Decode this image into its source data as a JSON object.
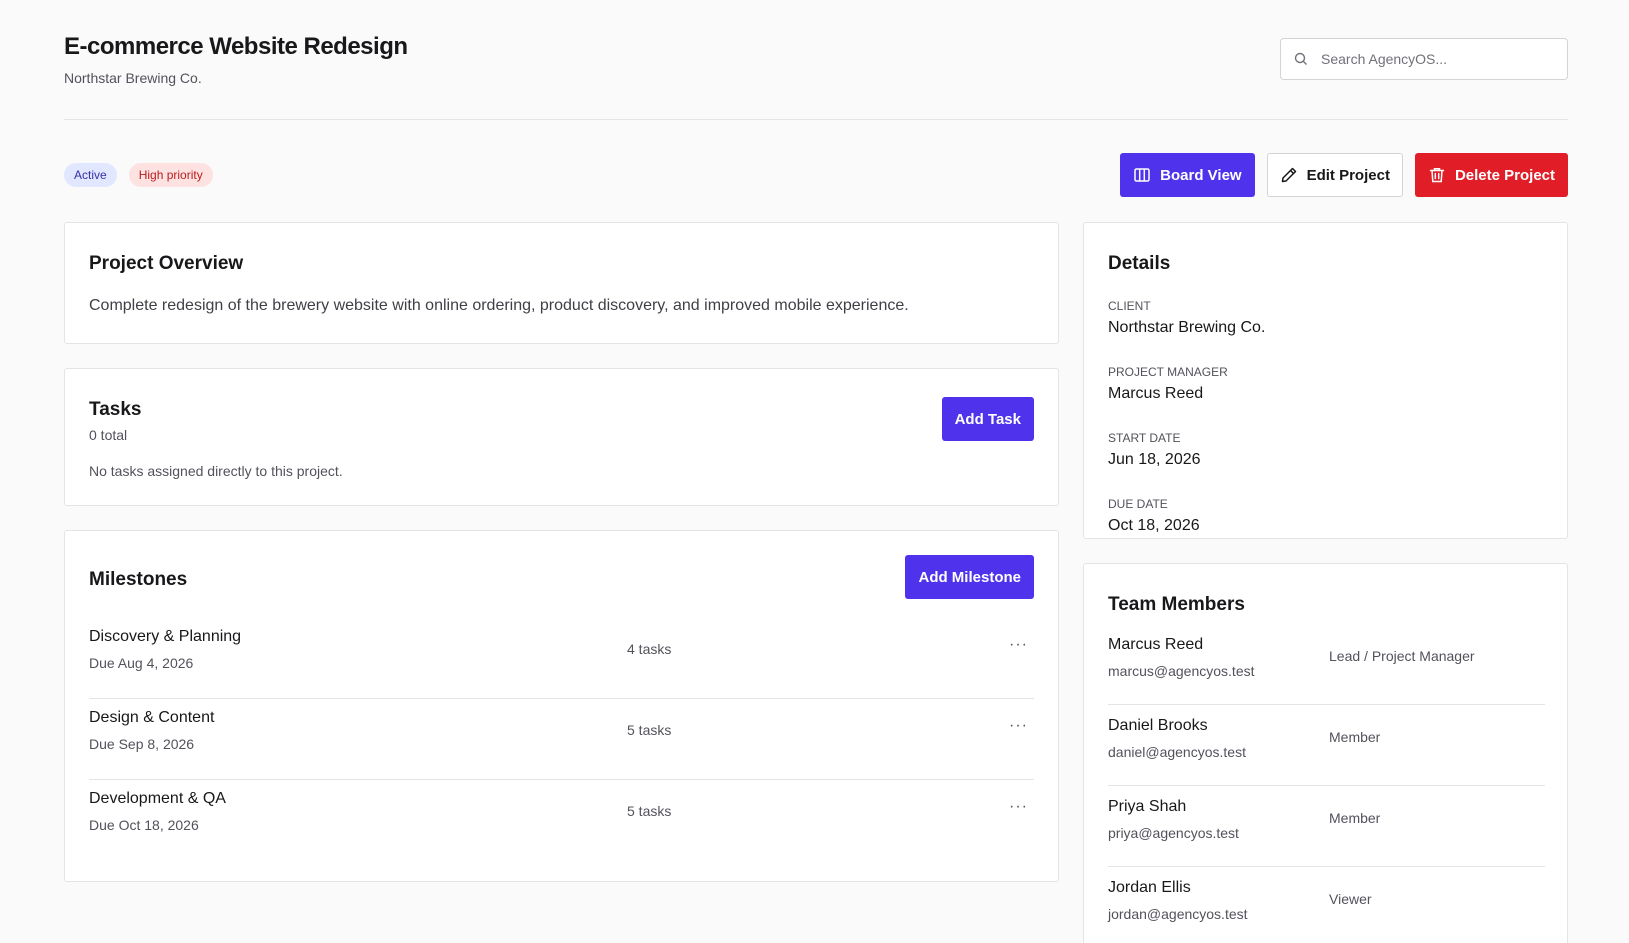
{
  "header": {
    "title": "E-commerce Website Redesign",
    "subtitle": "Northstar Brewing Co.",
    "search_placeholder": "Search AgencyOS..."
  },
  "badges": {
    "status": "Active",
    "priority": "High priority"
  },
  "actions": {
    "board_view": "Board View",
    "edit_project": "Edit Project",
    "delete_project": "Delete Project"
  },
  "overview": {
    "title": "Project Overview",
    "description": "Complete redesign of the brewery website with online ordering, product discovery, and improved mobile experience."
  },
  "tasks": {
    "title": "Tasks",
    "count": "0 total",
    "empty_message": "No tasks assigned directly to this project.",
    "add_label": "Add Task"
  },
  "milestones": {
    "title": "Milestones",
    "add_label": "Add Milestone",
    "items": [
      {
        "name": "Discovery & Planning",
        "due": "Due Aug 4, 2026",
        "tasks": "4 tasks"
      },
      {
        "name": "Design & Content",
        "due": "Due Sep 8, 2026",
        "tasks": "5 tasks"
      },
      {
        "name": "Development & QA",
        "due": "Due Oct 18, 2026",
        "tasks": "5 tasks"
      }
    ],
    "more_label": "···"
  },
  "details": {
    "title": "Details",
    "client_label": "Client",
    "client": "Northstar Brewing Co.",
    "manager_label": "Project Manager",
    "manager": "Marcus Reed",
    "start_label": "Start Date",
    "start": "Jun 18, 2026",
    "due_label": "Due Date",
    "due": "Oct 18, 2026"
  },
  "team": {
    "title": "Team Members",
    "members": [
      {
        "name": "Marcus Reed",
        "email": "marcus@agencyos.test",
        "role": "Lead / Project Manager"
      },
      {
        "name": "Daniel Brooks",
        "email": "daniel@agencyos.test",
        "role": "Member"
      },
      {
        "name": "Priya Shah",
        "email": "priya@agencyos.test",
        "role": "Member"
      },
      {
        "name": "Jordan Ellis",
        "email": "jordan@agencyos.test",
        "role": "Viewer"
      }
    ]
  },
  "colors": {
    "primary": "#4f33ec",
    "danger": "#e11d27",
    "badge_active_bg": "#e0e7ff",
    "badge_priority_bg": "#fee2e2"
  },
  "icons": {
    "search": "search-icon",
    "board_view": "columns-icon",
    "edit": "pencil-icon",
    "delete": "trash-icon"
  }
}
